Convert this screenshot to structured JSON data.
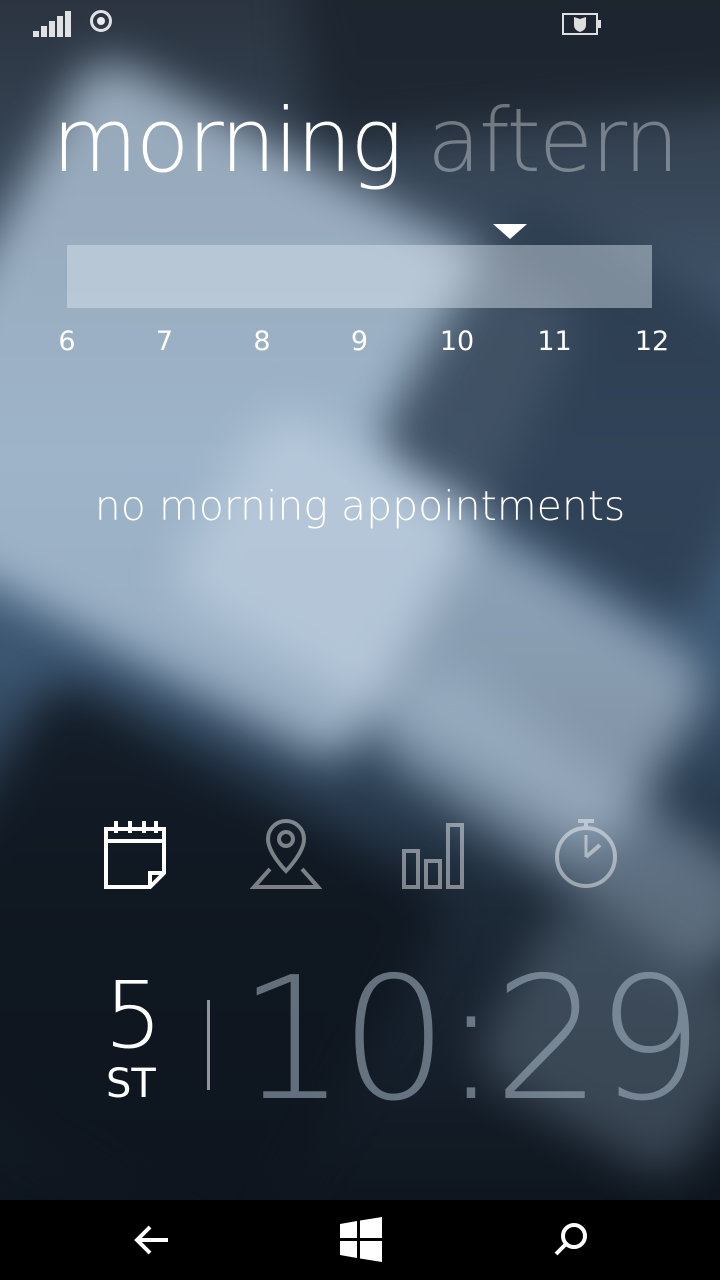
{
  "tabs": {
    "active": "morning",
    "next": "aftern"
  },
  "timeline": {
    "hours": [
      "6",
      "7",
      "8",
      "9",
      "10",
      "11",
      "12"
    ],
    "current_time_fraction": 0.75
  },
  "message": "no morning appointments",
  "feature_icons": [
    "calendar-icon",
    "location-pin-icon",
    "stats-bar-icon",
    "stopwatch-icon"
  ],
  "date": {
    "day": "5",
    "suffix": "ST"
  },
  "clock": {
    "time": "10:29"
  },
  "nav": [
    "back-icon",
    "windows-icon",
    "search-icon"
  ]
}
